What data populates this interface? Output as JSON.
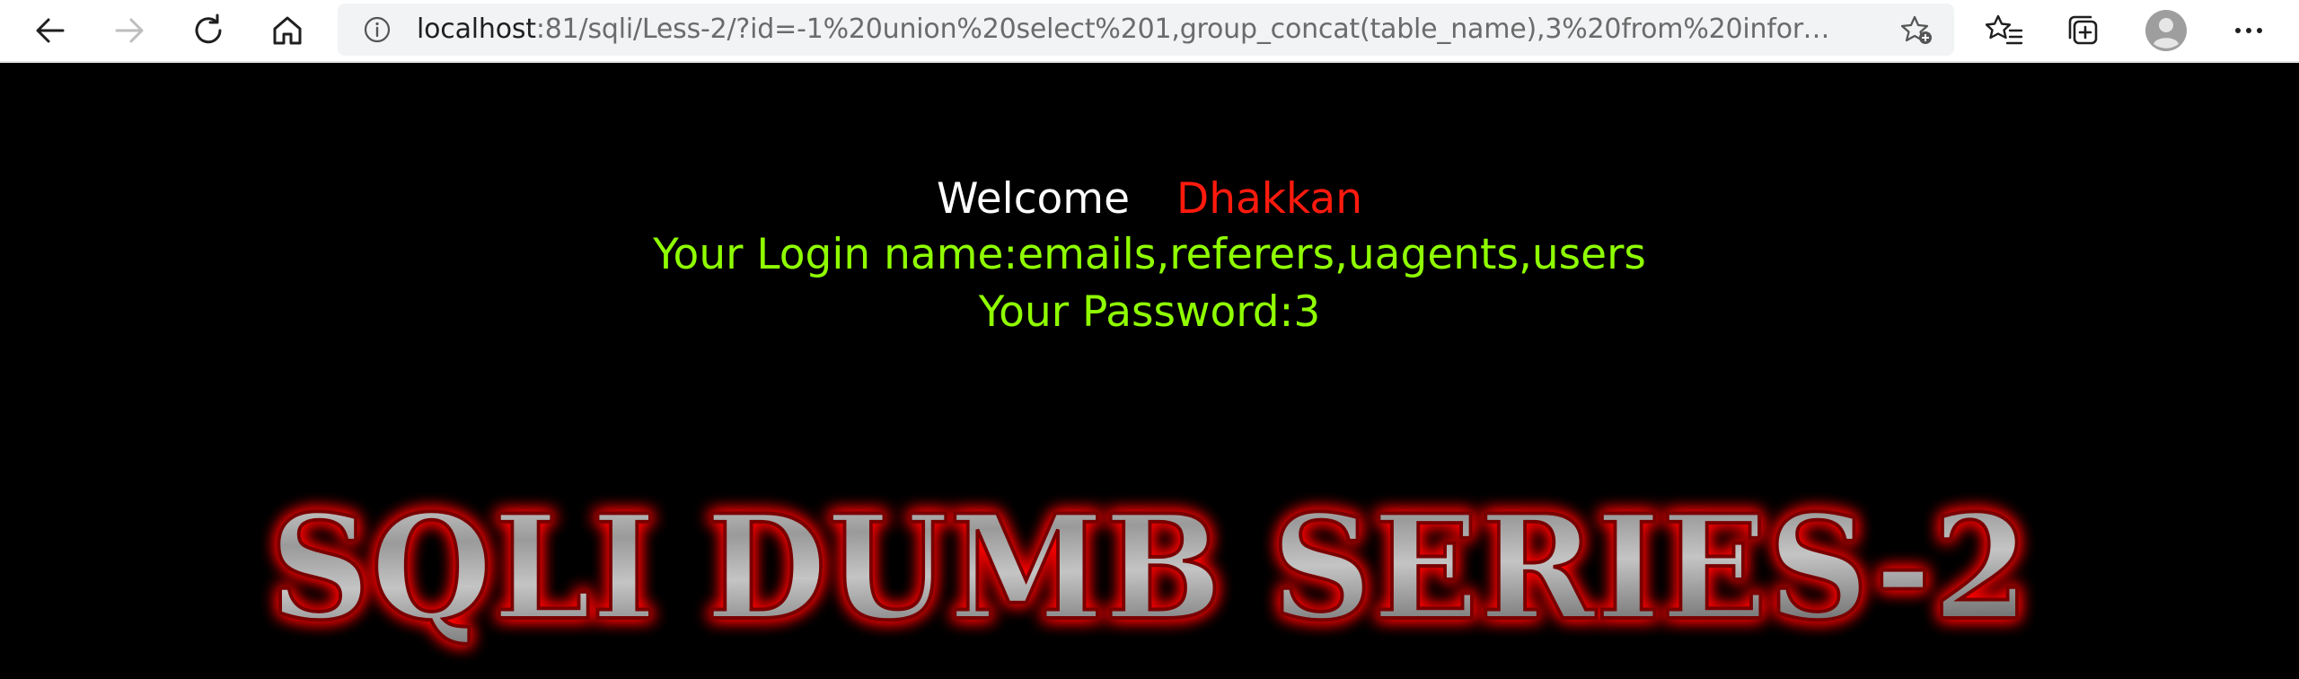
{
  "browser": {
    "url_host": "localhost",
    "url_rest": ":81/sqli/Less-2/?id=-1%20union%20select%201,group_concat(table_name),3%20from%20information_sc...",
    "icons": [
      "back-icon",
      "forward-icon",
      "refresh-icon",
      "home-icon",
      "info-icon",
      "add-favorite-icon",
      "favorites-icon",
      "collections-icon",
      "profile-icon",
      "more-icon"
    ]
  },
  "page": {
    "welcome_label": "Welcome",
    "welcome_name": "Dhakkan",
    "login_line": "Your Login name:emails,referers,uagents,users",
    "password_line": "Your Password:3",
    "banner_text": "SQLI DUMB SERIES-2"
  },
  "colors": {
    "background": "#000000",
    "welcome": "#ffffff",
    "name": "#ff1a0d",
    "result": "#8fff00",
    "banner_glow": "#ff0000"
  }
}
